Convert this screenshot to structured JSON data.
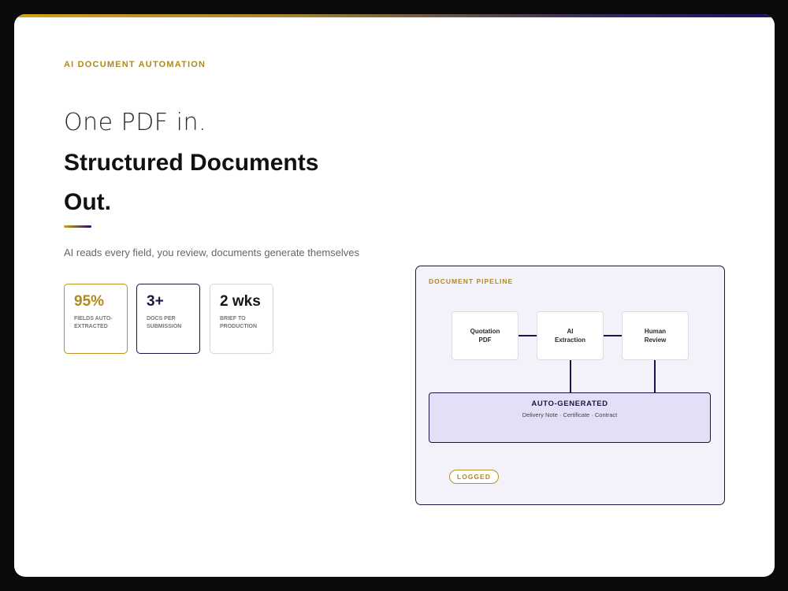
{
  "hero": {
    "eyebrow": "AI DOCUMENT AUTOMATION",
    "headline_light": "One PDF in.",
    "headline_bold_1": "Structured Documents",
    "headline_bold_2": "Out.",
    "subtitle": "AI reads every field, you review, documents generate themselves"
  },
  "stats": [
    {
      "value": "95%",
      "label": "FIELDS AUTO-\nEXTRACTED"
    },
    {
      "value": "3+",
      "label": "DOCS PER\nSUBMISSION"
    },
    {
      "value": "2 wks",
      "label": "BRIEF TO\nPRODUCTION"
    }
  ],
  "pipeline": {
    "title": "DOCUMENT PIPELINE",
    "nodes": [
      {
        "label": "Quotation\nPDF"
      },
      {
        "label": "AI\nExtraction"
      },
      {
        "label": "Human\nReview"
      }
    ],
    "output": {
      "title": "AUTO-GENERATED",
      "subtitle": "Delivery Note · Certificate · Contract"
    },
    "badge": "LOGGED"
  },
  "colors": {
    "gold": "#b08a1a",
    "navy": "#1b1548",
    "pipeline_bg": "#f3f2fb",
    "output_bg": "#e2e0f6"
  }
}
